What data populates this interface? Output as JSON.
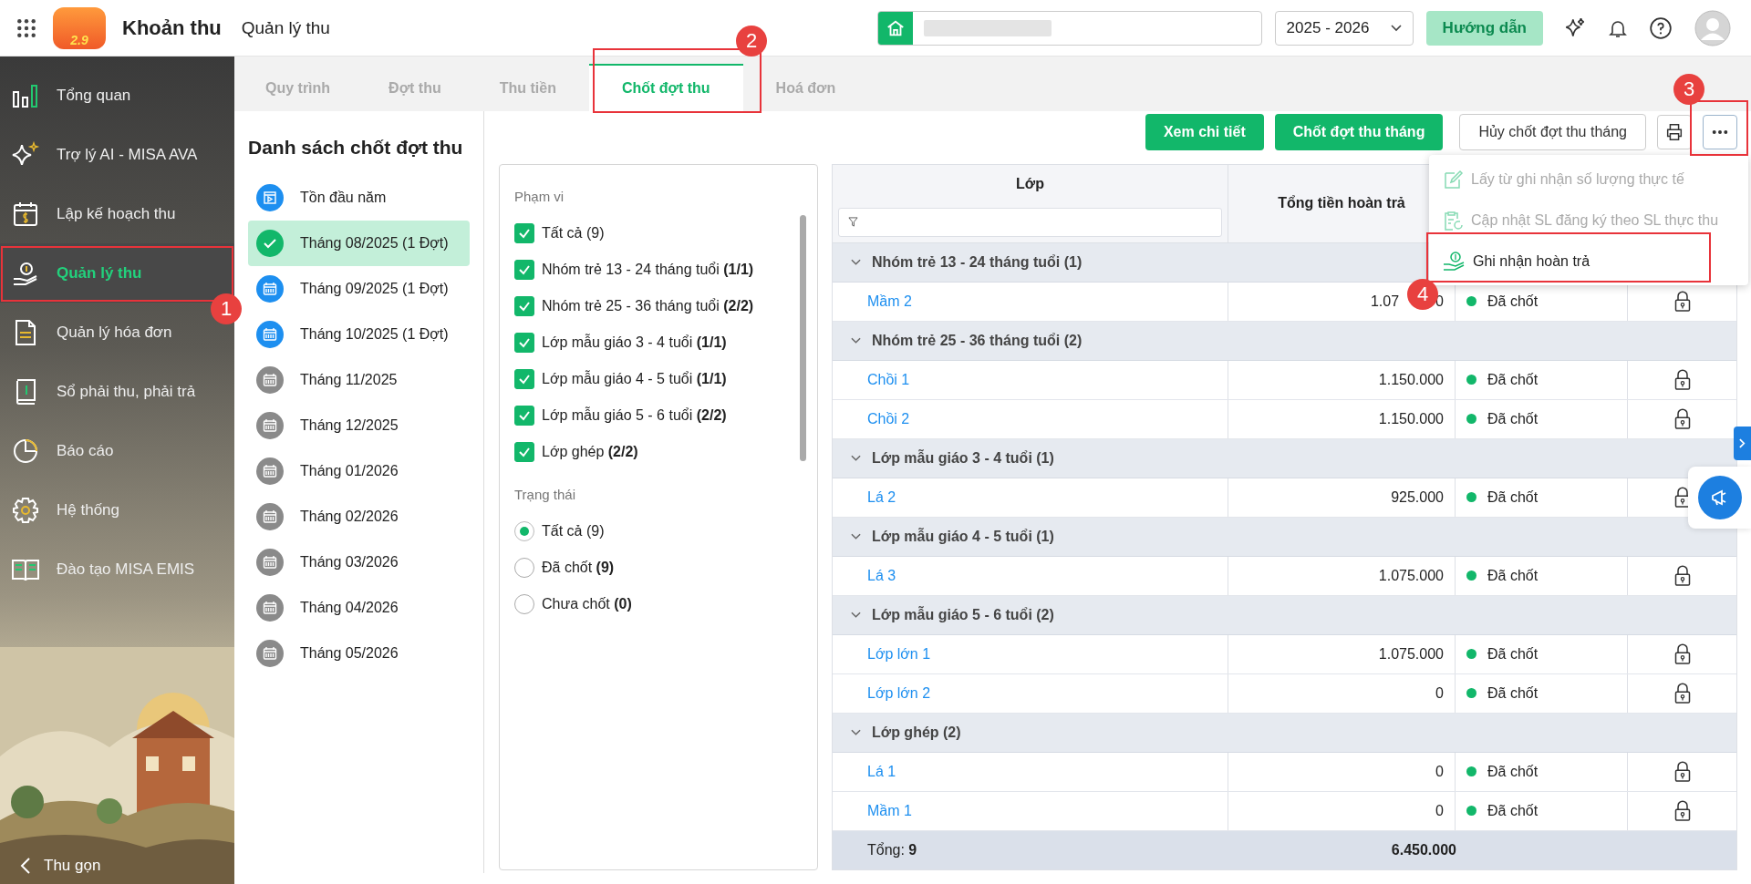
{
  "app": {
    "logo_mark": "2.9",
    "title": "Khoản thu",
    "page_title": "Quản lý thu"
  },
  "header": {
    "school_year": "2025 - 2026",
    "guide_button": "Hướng dẫn"
  },
  "sidebar": {
    "items": [
      {
        "label": "Tổng quan",
        "selected": false
      },
      {
        "label": "Trợ lý AI - MISA AVA",
        "selected": false
      },
      {
        "label": "Lập kế hoạch thu",
        "selected": false
      },
      {
        "label": "Quản lý thu",
        "selected": true
      },
      {
        "label": "Quản lý hóa đơn",
        "selected": false
      },
      {
        "label": "Sổ phải thu, phải trả",
        "selected": false
      },
      {
        "label": "Báo cáo",
        "selected": false
      },
      {
        "label": "Hệ thống",
        "selected": false
      },
      {
        "label": "Đào tạo MISA EMIS",
        "selected": false
      }
    ],
    "collapse": "Thu gọn"
  },
  "tabs": [
    {
      "label": "Quy trình",
      "selected": false
    },
    {
      "label": "Đợt thu",
      "selected": false
    },
    {
      "label": "Thu tiền",
      "selected": false
    },
    {
      "label": "Chốt đợt thu",
      "selected": true
    },
    {
      "label": "Hoá đơn",
      "selected": false
    }
  ],
  "period_list": {
    "title": "Danh sách chốt đợt thu",
    "items": [
      {
        "label": "Tồn đầu năm",
        "kind": "opening",
        "selected": false
      },
      {
        "label": "Tháng 08/2025 (1 Đợt)",
        "kind": "closed",
        "selected": true
      },
      {
        "label": "Tháng 09/2025 (1 Đợt)",
        "kind": "open",
        "selected": false
      },
      {
        "label": "Tháng 10/2025 (1 Đợt)",
        "kind": "open",
        "selected": false
      },
      {
        "label": "Tháng 11/2025",
        "kind": "future",
        "selected": false
      },
      {
        "label": "Tháng 12/2025",
        "kind": "future",
        "selected": false
      },
      {
        "label": "Tháng 01/2026",
        "kind": "future",
        "selected": false
      },
      {
        "label": "Tháng 02/2026",
        "kind": "future",
        "selected": false
      },
      {
        "label": "Tháng 03/2026",
        "kind": "future",
        "selected": false
      },
      {
        "label": "Tháng 04/2026",
        "kind": "future",
        "selected": false
      },
      {
        "label": "Tháng 05/2026",
        "kind": "future",
        "selected": false
      }
    ]
  },
  "filter": {
    "scope_label": "Phạm vi",
    "scope": [
      {
        "label": "Tất cả (9)",
        "checked": true
      },
      {
        "label": "Nhóm trẻ 13 - 24 tháng tuổi **(1/1)**",
        "checked": true
      },
      {
        "label": "Nhóm trẻ 25 - 36 tháng tuổi **(2/2)**",
        "checked": true
      },
      {
        "label": "Lớp mẫu giáo 3 - 4 tuổi **(1/1)**",
        "checked": true
      },
      {
        "label": "Lớp mẫu giáo 4 - 5 tuổi **(1/1)**",
        "checked": true
      },
      {
        "label": "Lớp mẫu giáo 5 - 6 tuổi **(2/2)**",
        "checked": true
      },
      {
        "label": "Lớp ghép **(2/2)**",
        "checked": true
      }
    ],
    "status_label": "Trạng thái",
    "status": [
      {
        "label": "Tất cả (9)",
        "selected": true
      },
      {
        "label": "Đã chốt **(9)**",
        "selected": false
      },
      {
        "label": "Chưa chốt **(0)**",
        "selected": false
      }
    ]
  },
  "toolbar": {
    "buttons": [
      {
        "label": "Xem chi tiết",
        "kind": "primary"
      },
      {
        "label": "Chốt đợt thu tháng",
        "kind": "primary"
      },
      {
        "label": "Hủy chốt đợt thu tháng",
        "kind": "outline"
      }
    ]
  },
  "more_menu": {
    "items": [
      {
        "label": "Lấy từ ghi nhận số lượng thực tế",
        "disabled": true
      },
      {
        "label": "Cập nhật SL đăng ký theo SL thực thu",
        "disabled": true
      },
      {
        "label": "Ghi nhận hoàn trả",
        "disabled": false
      }
    ]
  },
  "table": {
    "columns": [
      "Lớp",
      "Tổng tiền hoàn trả"
    ],
    "groups": [
      {
        "label": "Nhóm trẻ 13 - 24 tháng tuổi (1)",
        "expanded": true,
        "rows": [
          {
            "class": "Mầm 2",
            "refund": "1.07",
            "refund_tail": "0",
            "status": "Đã chốt"
          }
        ]
      },
      {
        "label": "Nhóm trẻ 25 - 36 tháng tuổi (2)",
        "expanded": true,
        "rows": [
          {
            "class": "Chồi 1",
            "refund": "1.150.000",
            "status": "Đã chốt"
          },
          {
            "class": "Chồi 2",
            "refund": "1.150.000",
            "status": "Đã chốt"
          }
        ]
      },
      {
        "label": "Lớp mẫu giáo 3 - 4 tuổi (1)",
        "expanded": true,
        "rows": [
          {
            "class": "Lá 2",
            "refund": "925.000",
            "status": "Đã chốt"
          }
        ]
      },
      {
        "label": "Lớp mẫu giáo 4 - 5 tuổi (1)",
        "expanded": true,
        "rows": [
          {
            "class": "Lá 3",
            "refund": "1.075.000",
            "status": "Đã chốt"
          }
        ]
      },
      {
        "label": "Lớp mẫu giáo 5 - 6 tuổi (2)",
        "expanded": true,
        "rows": [
          {
            "class": "Lớp lớn 1",
            "refund": "1.075.000",
            "status": "Đã chốt"
          },
          {
            "class": "Lớp lớn 2",
            "refund": "0",
            "status": "Đã chốt"
          }
        ]
      },
      {
        "label": "Lớp ghép (2)",
        "expanded": true,
        "rows": [
          {
            "class": "Lá 1",
            "refund": "0",
            "status": "Đã chốt"
          },
          {
            "class": "Mầm 1",
            "refund": "0",
            "status": "Đã chốt"
          }
        ]
      }
    ],
    "footer": {
      "count": "Tổng: **9**",
      "total": "6.450.000"
    }
  },
  "annotations": [
    {
      "label": "1"
    },
    {
      "label": "2"
    },
    {
      "label": "3"
    },
    {
      "label": "4"
    }
  ]
}
